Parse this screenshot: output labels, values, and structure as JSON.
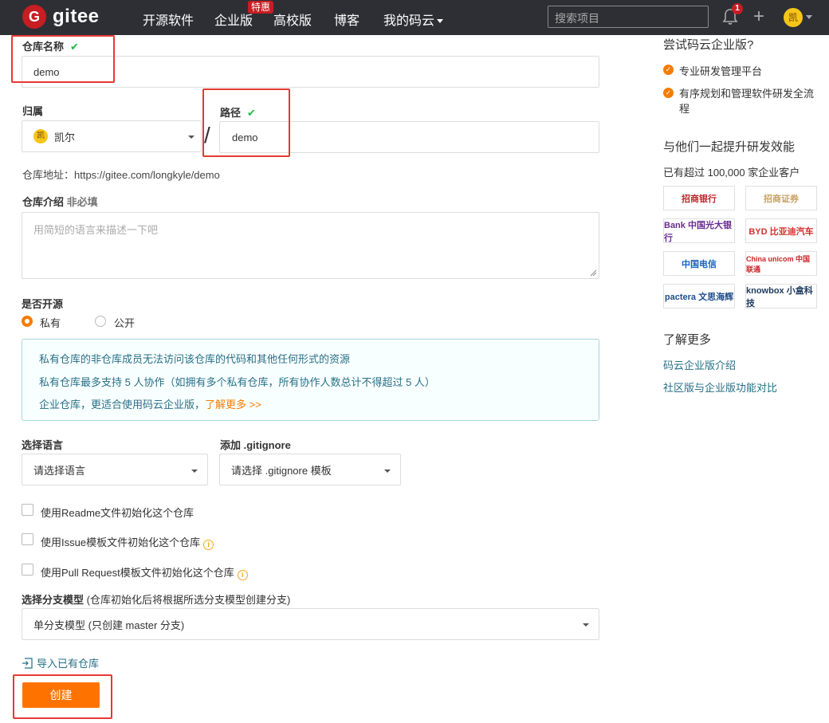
{
  "nav": {
    "brand": "gitee",
    "logo_letter": "G",
    "links": [
      "开源软件",
      "企业版",
      "高校版",
      "博客",
      "我的码云"
    ],
    "badge": "特惠",
    "search_placeholder": "搜索项目",
    "notification_count": "1",
    "plus": "+",
    "user_avatar_text": "凯",
    "colors": {
      "bar": "#2e2f35",
      "brand_red": "#c71d23"
    },
    "icons": [
      "bell-icon",
      "plus-icon",
      "chevron-down-icon"
    ]
  },
  "form": {
    "repo_name": {
      "label": "仓库名称",
      "check": "✔",
      "value": "demo"
    },
    "owner": {
      "label": "归属",
      "avatar_text": "凯",
      "value": "凯尔"
    },
    "path": {
      "label": "路径",
      "check": "✔",
      "value": "demo",
      "separator": "/"
    },
    "address": "仓库地址：https://gitee.com/longkyle/demo",
    "description": {
      "label": "仓库介绍",
      "hint": "非必填",
      "placeholder": "用简短的语言来描述一下吧"
    },
    "visibility": {
      "label": "是否开源",
      "options": [
        "私有",
        "公开"
      ],
      "selected": "私有"
    },
    "info_lines": [
      "私有仓库的非仓库成员无法访问该仓库的代码和其他任何形式的资源",
      "私有仓库最多支持 5 人协作（如拥有多个私有仓库，所有协作人数总计不得超过 5 人）",
      "企业仓库，更适合使用码云企业版，"
    ],
    "info_link": "了解更多 >>",
    "language": {
      "label": "选择语言",
      "value": "请选择语言"
    },
    "gitignore": {
      "label": "添加 .gitignore",
      "value": "请选择 .gitignore 模板"
    },
    "checkboxes": [
      "使用Readme文件初始化这个仓库",
      "使用Issue模板文件初始化这个仓库",
      "使用Pull Request模板文件初始化这个仓库"
    ],
    "info_icon": "i",
    "branch_model": {
      "label": "选择分支模型",
      "note": " (仓库初始化后将根据所选分支模型创建分支)",
      "value": "单分支模型 (只创建 master 分支)"
    },
    "import_link": "导入已有仓库",
    "create_button": "创建",
    "accent": "#fe7300"
  },
  "sidebar": {
    "try_title": "尝试码云企业版?",
    "features": [
      "专业研发管理平台",
      "有序规划和管理软件研发全流程"
    ],
    "feature_check": "✓",
    "together_title": "与他们一起提升研发效能",
    "customers": "已有超过 100,000 家企业客户",
    "logos": [
      "招商银行",
      "招商证券",
      "Bank 中国光大银行",
      "BYD 比亚迪汽车",
      "中国电信",
      "China unicom 中国联通",
      "pactera 文思海辉",
      "knowbox 小盒科技"
    ],
    "learn_title": "了解更多",
    "links": [
      "码云企业版介绍",
      "社区版与企业版功能对比"
    ]
  }
}
